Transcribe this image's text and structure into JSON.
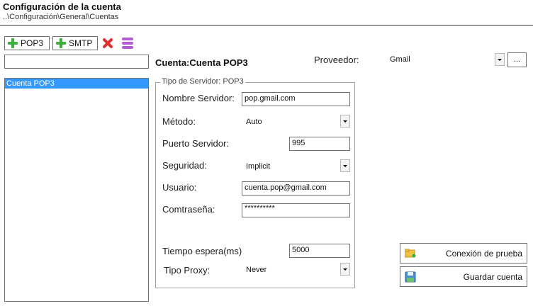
{
  "header": {
    "title": "Configuración de la cuenta",
    "breadcrumb": "..\\Configuración\\General\\Cuentas"
  },
  "toolbar": {
    "pop3_label": "POP3",
    "smtp_label": "SMTP"
  },
  "sidebar": {
    "search_value": "",
    "items": [
      {
        "label": "Cuenta POP3",
        "selected": true
      }
    ]
  },
  "account": {
    "prefix": "Cuenta:",
    "name": "Cuenta POP3",
    "provider_label": "Proveedor:",
    "provider_value": "Gmail",
    "provider_more": "..."
  },
  "server": {
    "legend": "Tipo de Servidor: POP3",
    "host_label": "Nombre Servidor:",
    "host_value": "pop.gmail.com",
    "method_label": "Método:",
    "method_value": "Auto",
    "port_label": "Puerto Servidor:",
    "port_value": "995",
    "security_label": "Seguridad:",
    "security_value": "Implicit",
    "user_label": "Usuario:",
    "user_value": "cuenta.pop@gmail.com",
    "password_label": "Comtraseña:",
    "password_value": "**********",
    "timeout_label": "Tiempo espera(ms)",
    "timeout_value": "5000",
    "proxy_label": "Tipo Proxy:",
    "proxy_value": "Never"
  },
  "actions": {
    "test_label": "Conexión de prueba",
    "save_label": "Guardar cuenta"
  },
  "icons": {
    "add": "plus-icon",
    "delete": "delete-x-icon",
    "db": "database-icon",
    "test": "folder-connection-icon",
    "save": "save-disk-icon"
  }
}
